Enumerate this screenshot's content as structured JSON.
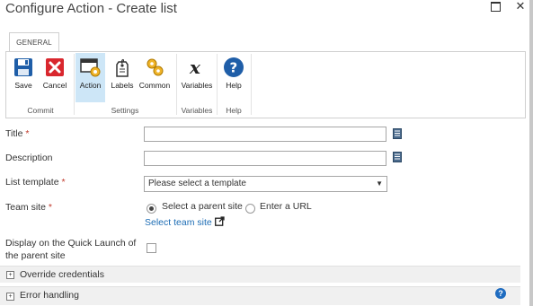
{
  "dialog": {
    "title": "Configure Action - Create list",
    "maximize_label": "maximize",
    "close_glyph": "✕"
  },
  "ribbon": {
    "tab": "GENERAL",
    "buttons": {
      "save": "Save",
      "cancel": "Cancel",
      "action": "Action",
      "labels": "Labels",
      "common": "Common",
      "variables": "Variables",
      "help": "Help"
    },
    "groups": {
      "commit": "Commit",
      "settings": "Settings",
      "variables": "Variables",
      "help": "Help"
    },
    "icons": [
      "save-icon",
      "cancel-icon",
      "action-icon",
      "labels-icon",
      "common-icon",
      "variables-icon",
      "help-icon"
    ],
    "accent": "#0072c6",
    "selected_bg": "#cde6f7"
  },
  "form": {
    "title_label": "Title",
    "description_label": "Description",
    "list_template_label": "List template",
    "list_template_value": "Please select a template",
    "team_site_label": "Team site",
    "radio_parent": "Select a parent site",
    "radio_url": "Enter a URL",
    "select_team_site_link": "Select team site",
    "quick_launch_line1": "Display on the Quick Launch of",
    "quick_launch_line2": "the parent site",
    "required_marker": "*"
  },
  "sections": {
    "override_credentials": "Override credentials",
    "error_handling": "Error handling"
  },
  "glyphs": {
    "plus": "+",
    "dropdown": "▼",
    "help": "?",
    "external": "⇱"
  }
}
